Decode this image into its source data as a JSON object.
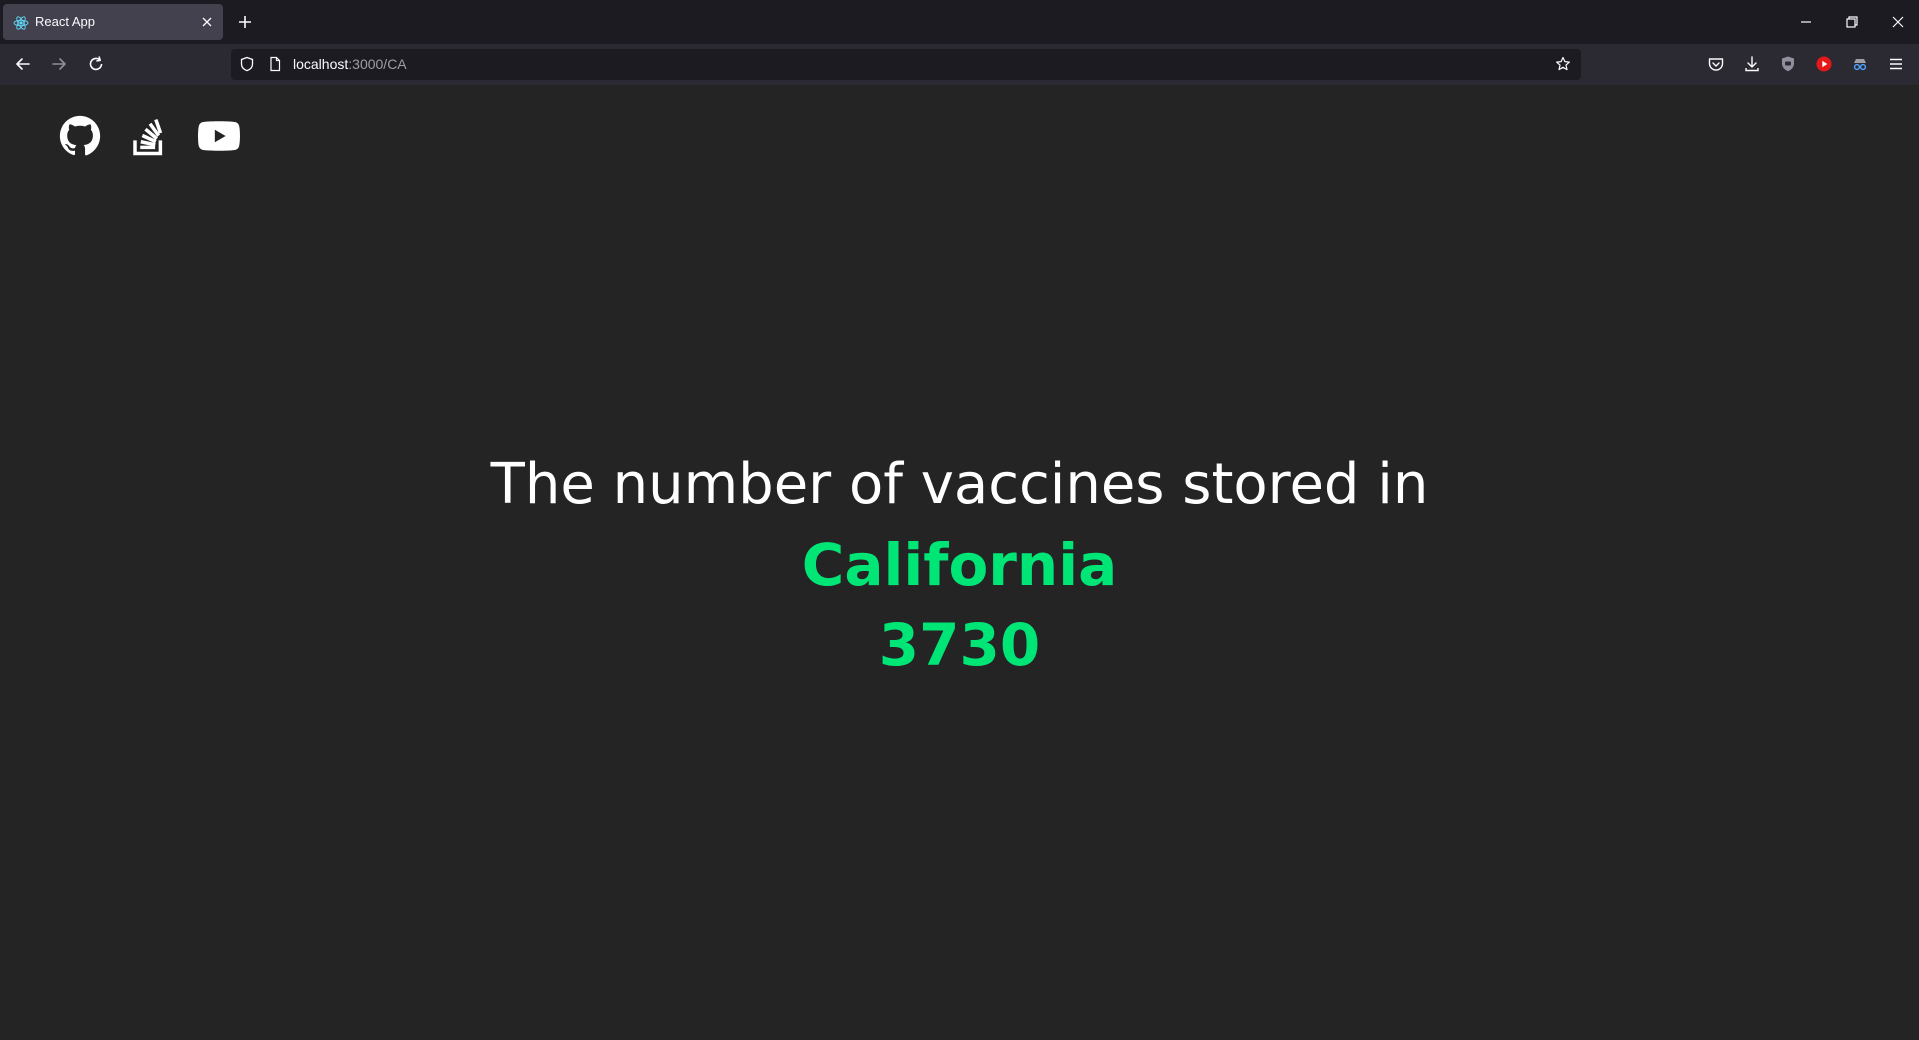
{
  "browser": {
    "tab": {
      "title": "React App",
      "favicon": "react-icon"
    },
    "url": {
      "host": "localhost",
      "path": ":3000/CA"
    }
  },
  "page": {
    "social_links": [
      {
        "icon": "github-icon"
      },
      {
        "icon": "stackoverflow-icon"
      },
      {
        "icon": "youtube-icon"
      }
    ],
    "heading": "The number of vaccines stored in",
    "state": "California",
    "count": "3730",
    "accent_color": "#00e676"
  }
}
